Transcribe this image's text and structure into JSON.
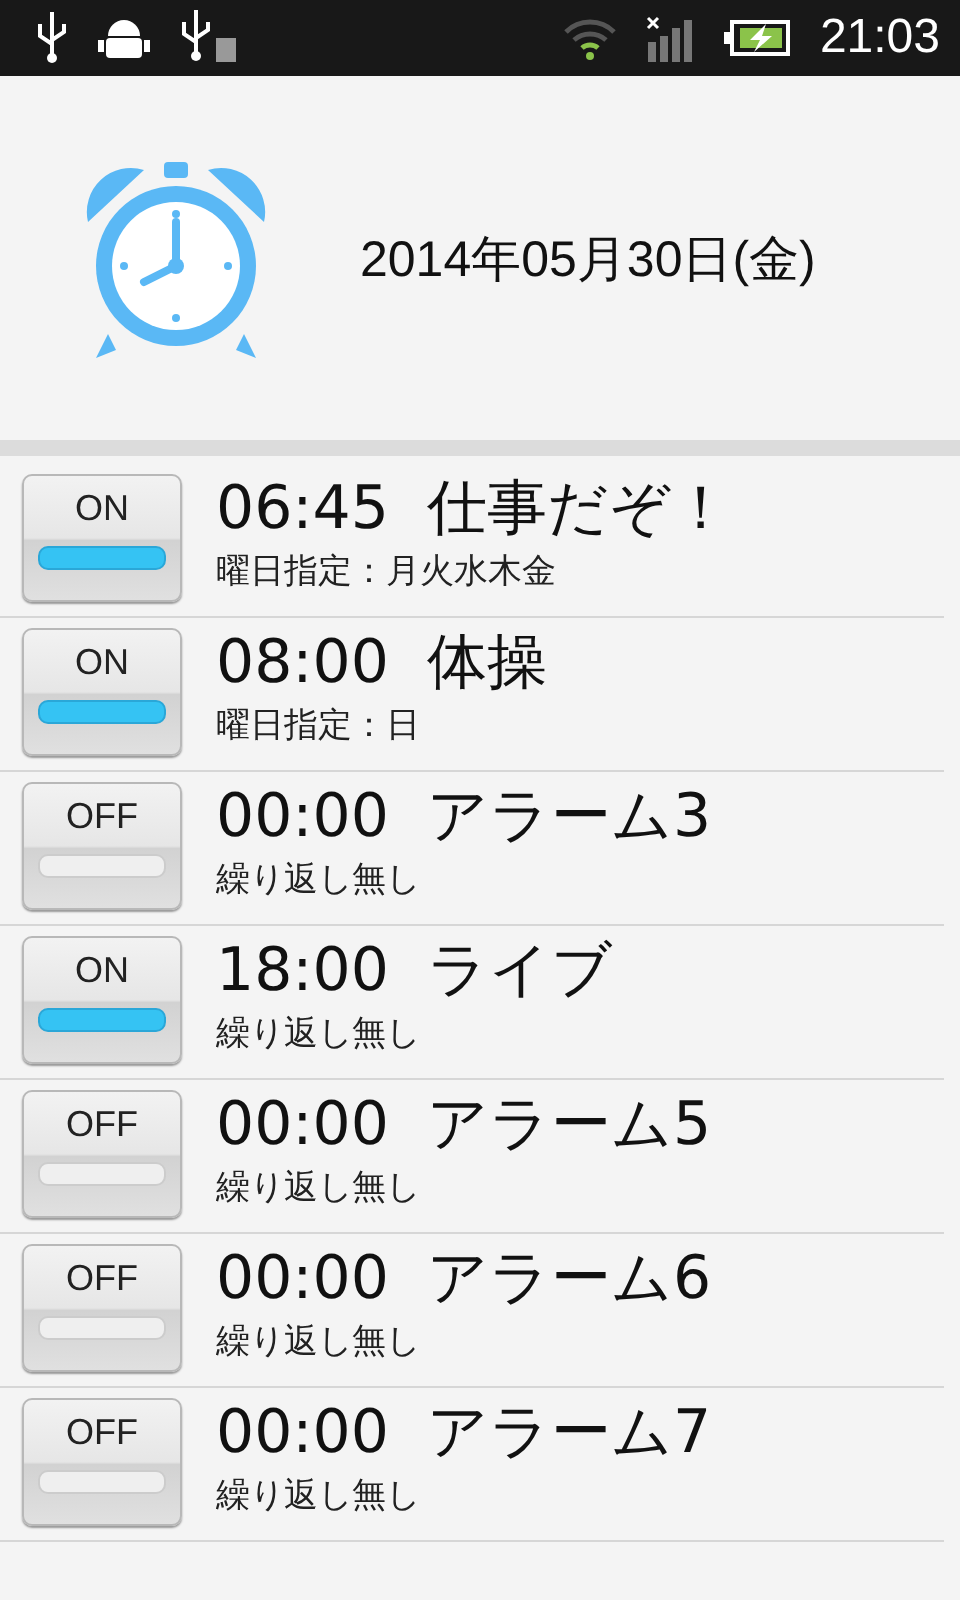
{
  "status_bar": {
    "time": "21:03"
  },
  "header": {
    "date": "2014年05月30日(金)"
  },
  "alarms": [
    {
      "toggle": "ON",
      "on": true,
      "time": "06:45",
      "name": "仕事だぞ！",
      "repeat": "曜日指定：月火水木金"
    },
    {
      "toggle": "ON",
      "on": true,
      "time": "08:00",
      "name": "体操",
      "repeat": "曜日指定：日"
    },
    {
      "toggle": "OFF",
      "on": false,
      "time": "00:00",
      "name": "アラーム3",
      "repeat": "繰り返し無し"
    },
    {
      "toggle": "ON",
      "on": true,
      "time": "18:00",
      "name": "ライブ",
      "repeat": "繰り返し無し"
    },
    {
      "toggle": "OFF",
      "on": false,
      "time": "00:00",
      "name": "アラーム5",
      "repeat": "繰り返し無し"
    },
    {
      "toggle": "OFF",
      "on": false,
      "time": "00:00",
      "name": "アラーム6",
      "repeat": "繰り返し無し"
    },
    {
      "toggle": "OFF",
      "on": false,
      "time": "00:00",
      "name": "アラーム7",
      "repeat": "繰り返し無し"
    }
  ]
}
